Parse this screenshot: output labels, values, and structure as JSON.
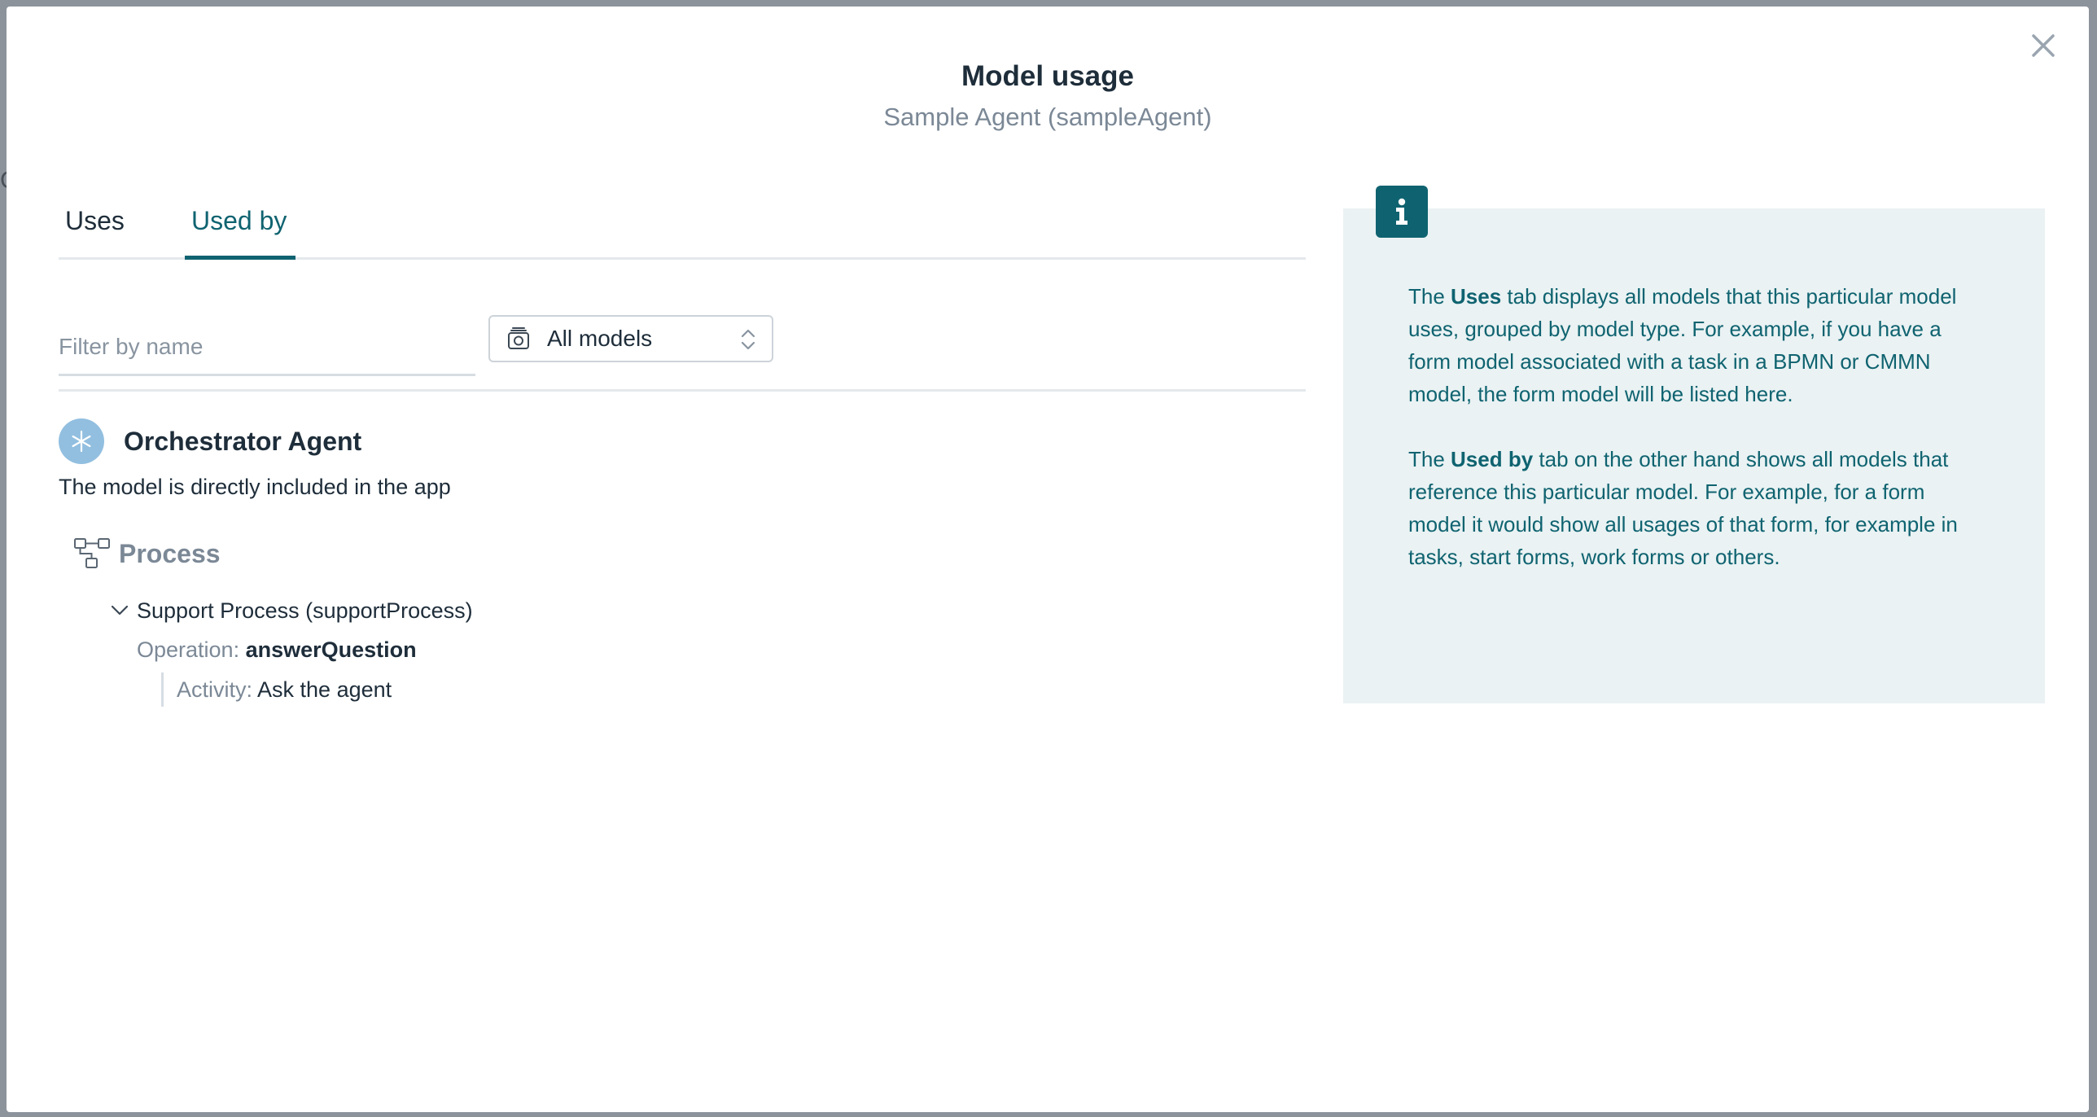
{
  "backdrop": {
    "partial_text": "C"
  },
  "modal": {
    "title": "Model usage",
    "subtitle": "Sample Agent (sampleAgent)"
  },
  "tabs": [
    {
      "label": "Uses",
      "active": false
    },
    {
      "label": "Used by",
      "active": true
    }
  ],
  "filter": {
    "placeholder": "Filter by name",
    "value": ""
  },
  "model_select": {
    "selected": "All models",
    "icon": "stack-icon"
  },
  "results": {
    "model": {
      "name": "Orchestrator Agent",
      "icon": "asterisk-icon",
      "description": "The model is directly included in the app"
    },
    "group": {
      "label": "Process",
      "icon": "process-icon",
      "items": [
        {
          "name": "Support Process (supportProcess)",
          "expanded": true,
          "operation_label": "Operation:",
          "operation_value": "answerQuestion",
          "activity_label": "Activity:",
          "activity_value": "Ask the agent"
        }
      ]
    }
  },
  "info": {
    "p1_lead": "The ",
    "p1_bold": "Uses",
    "p1_rest": " tab displays all models that this particular model uses, grouped by model type. For example, if you have a form model associated with a task in a BPMN or CMMN model, the form model will be listed here.",
    "p2_lead": "The ",
    "p2_bold": "Used by",
    "p2_rest": " tab on the other hand shows all models that reference this particular model. For example, for a form model it would show all usages of that form, for example in tasks, start forms, work forms or others."
  },
  "colors": {
    "accent": "#0f6370",
    "info_bg": "#eaf2f3",
    "agent_icon_bg": "#92bfe0",
    "text": "#1e2d3a",
    "muted": "#7b8896",
    "backdrop": "#8d939b"
  }
}
